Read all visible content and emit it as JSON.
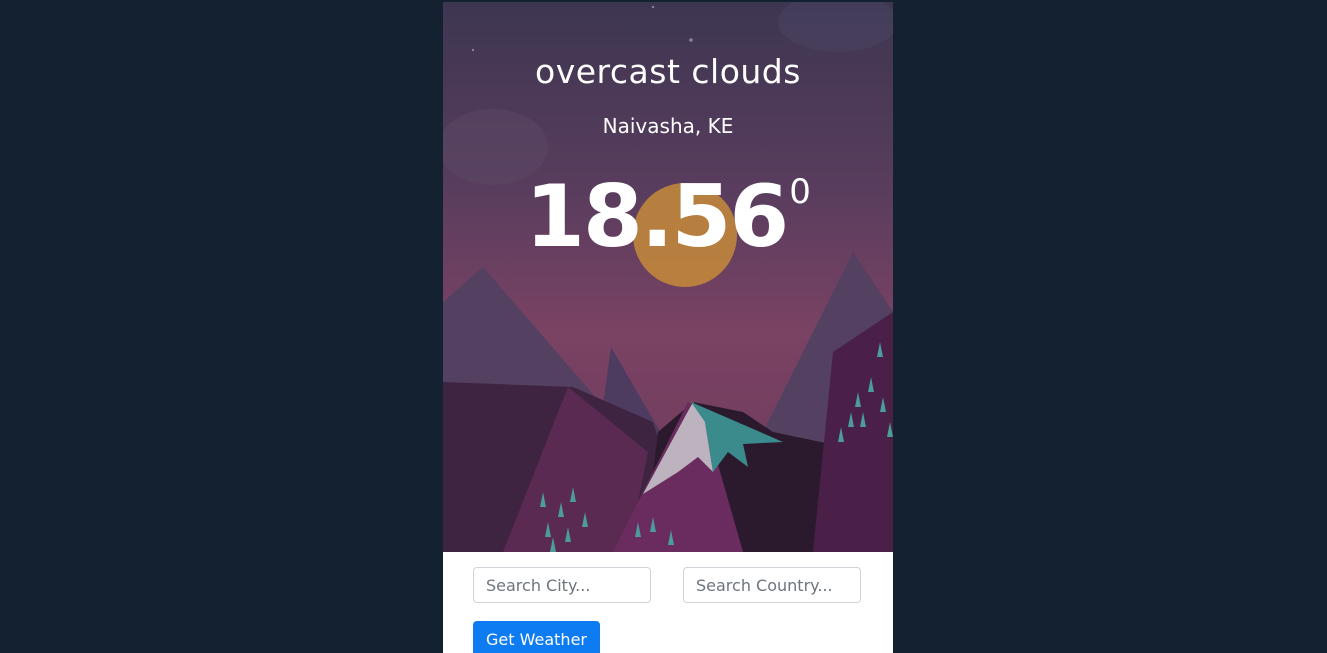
{
  "weather": {
    "description": "overcast clouds",
    "location": "Naivasha, KE",
    "temperature": "18.56",
    "degree_symbol": "0"
  },
  "form": {
    "city_placeholder": "Search City...",
    "country_placeholder": "Search Country...",
    "submit_label": "Get Weather"
  },
  "colors": {
    "page_background": "#132131",
    "button": "#0d7cf2",
    "sky_top": "#3d3651",
    "sky_bottom": "#7a4263",
    "sun": "#c58b3a"
  }
}
